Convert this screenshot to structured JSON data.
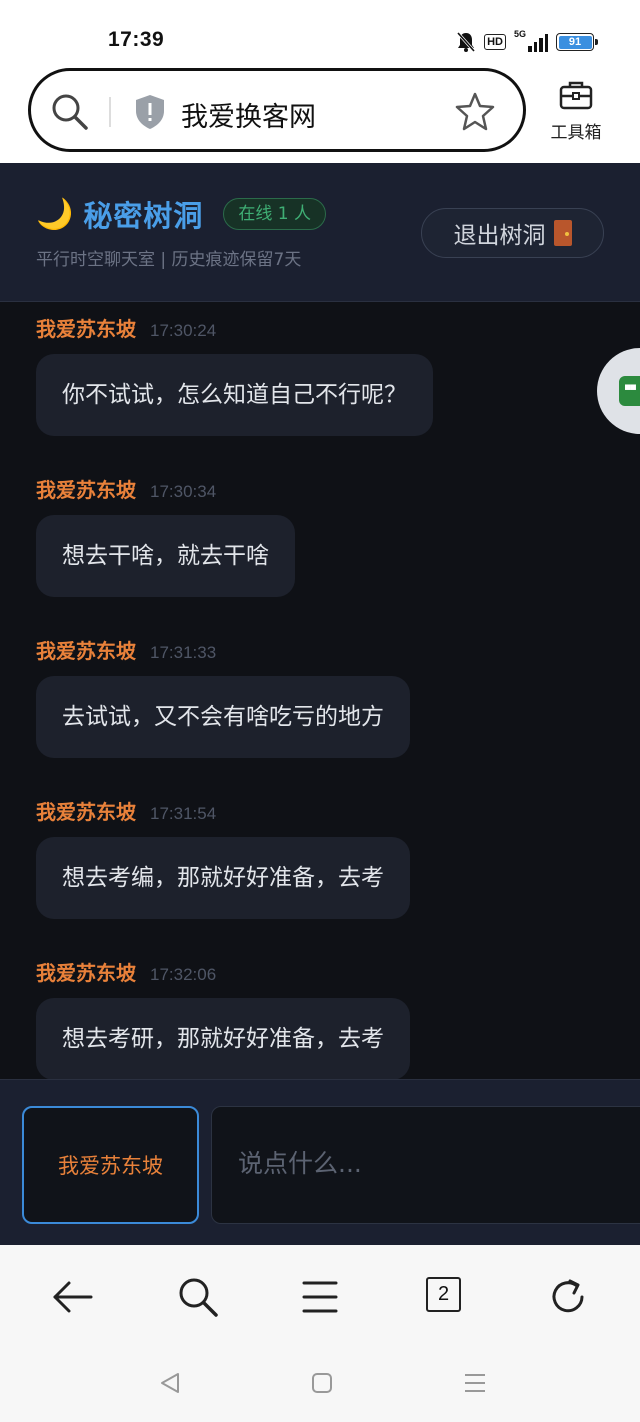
{
  "status_bar": {
    "time": "17:39",
    "hd": "HD",
    "network": "5G",
    "battery": "91"
  },
  "address_bar": {
    "url_text": "我爱换客网",
    "toolbox_label": "工具箱"
  },
  "chat": {
    "room_name": "秘密树洞",
    "online": "在线 1 人",
    "subtitle": "平行时空聊天室 | 历史痕迹保留7天",
    "exit_label": "退出树洞",
    "messages": [
      {
        "nick": "我爱苏东坡",
        "time": "17:30:24",
        "text": "你不试试，怎么知道自己不行呢？"
      },
      {
        "nick": "我爱苏东坡",
        "time": "17:30:34",
        "text": "想去干啥，就去干啥"
      },
      {
        "nick": "我爱苏东坡",
        "time": "17:31:33",
        "text": "去试试，又不会有啥吃亏的地方"
      },
      {
        "nick": "我爱苏东坡",
        "time": "17:31:54",
        "text": "想去考编，那就好好准备，去考"
      },
      {
        "nick": "我爱苏东坡",
        "time": "17:32:06",
        "text": "想去考研，那就好好准备，去考"
      }
    ],
    "composer": {
      "nickname": "我爱苏东坡",
      "placeholder": "说点什么..."
    }
  },
  "browser_nav": {
    "tab_count": "2"
  },
  "colors": {
    "accent_blue": "#4a9ee8",
    "nick_orange": "#e8813a",
    "online_green": "#3fae74",
    "chat_bg": "#0f1116"
  }
}
